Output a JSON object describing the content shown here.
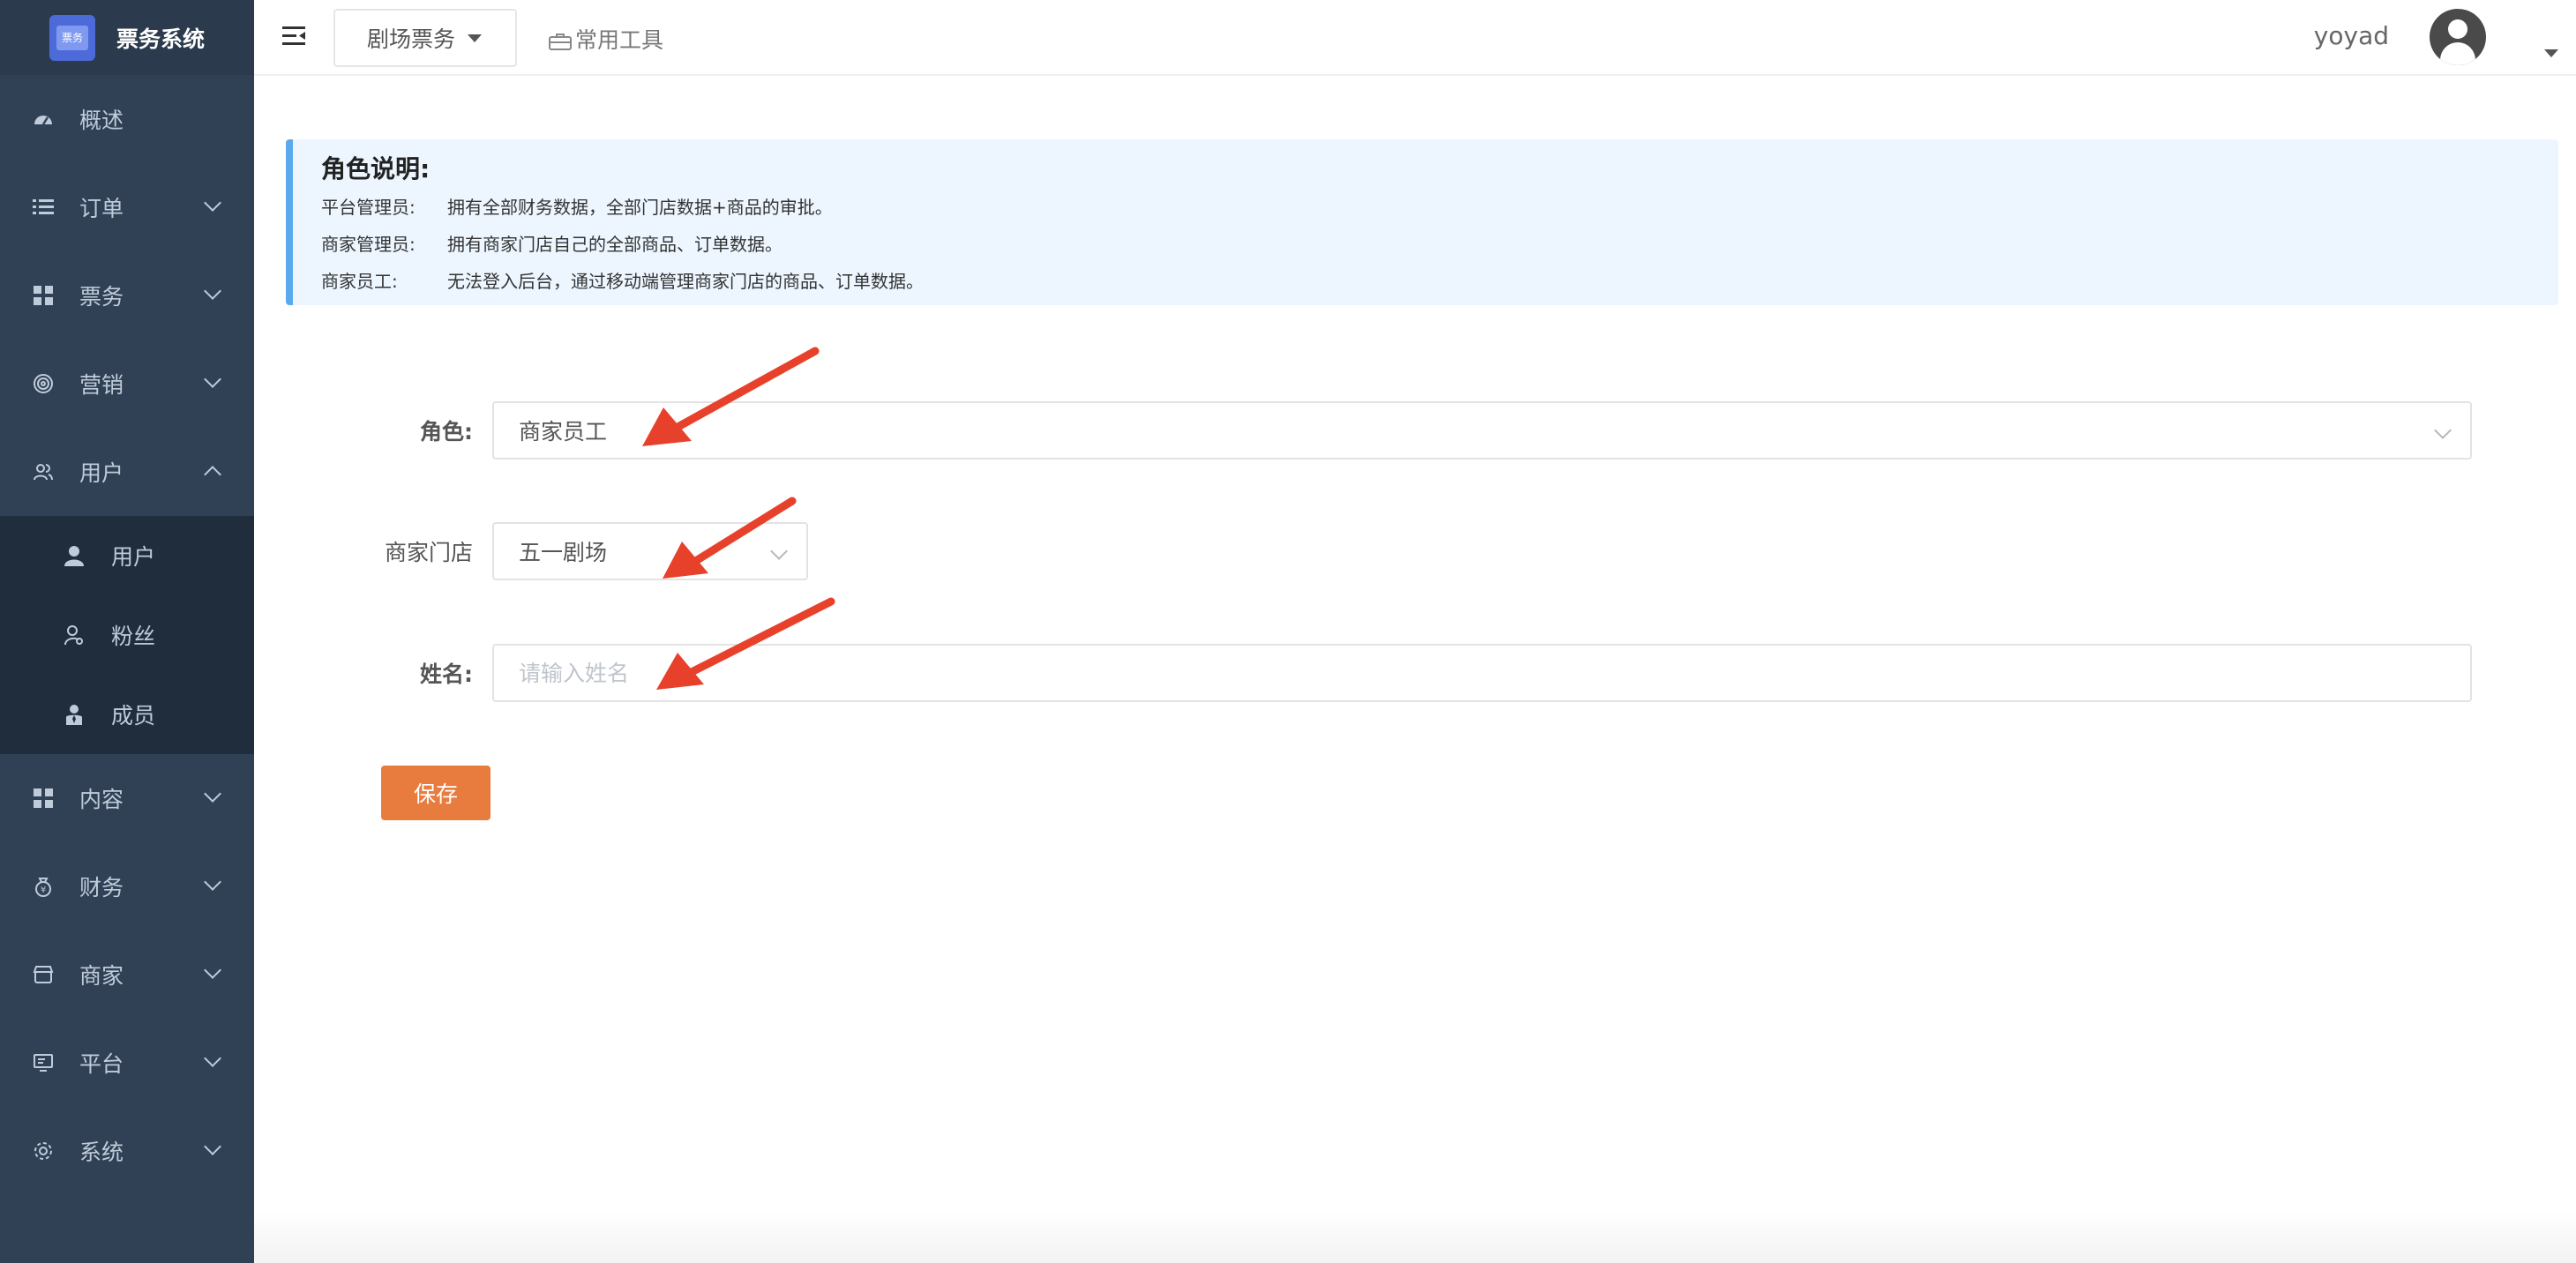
{
  "app": {
    "logo_mark_text": "票务",
    "title": "票务系统"
  },
  "header": {
    "project_select": "剧场票务",
    "tools_label": "常用工具",
    "user_name": "yoyad"
  },
  "sidebar": {
    "items": [
      {
        "label": "概述",
        "icon": "dashboard-icon"
      },
      {
        "label": "订单",
        "icon": "list-icon"
      },
      {
        "label": "票务",
        "icon": "grid-icon"
      },
      {
        "label": "营销",
        "icon": "target-icon"
      },
      {
        "label": "用户",
        "icon": "users-icon"
      },
      {
        "label": "内容",
        "icon": "grid-icon"
      },
      {
        "label": "财务",
        "icon": "money-bag-icon"
      },
      {
        "label": "商家",
        "icon": "store-icon"
      },
      {
        "label": "平台",
        "icon": "monitor-icon"
      },
      {
        "label": "系统",
        "icon": "gear-icon"
      }
    ],
    "user_submenu": [
      {
        "label": "用户",
        "icon": "person-icon"
      },
      {
        "label": "粉丝",
        "icon": "fans-icon"
      },
      {
        "label": "成员",
        "icon": "staff-icon"
      }
    ]
  },
  "notice": {
    "title": "角色说明:",
    "rows": [
      {
        "role": "平台管理员:",
        "desc": "拥有全部财务数据，全部门店数据+商品的审批。"
      },
      {
        "role": "商家管理员:",
        "desc": "拥有商家门店自己的全部商品、订单数据。"
      },
      {
        "role": "商家员工:",
        "desc": "无法登入后台，通过移动端管理商家门店的商品、订单数据。"
      }
    ]
  },
  "form": {
    "role_label": "角色:",
    "role_value": "商家员工",
    "store_label": "商家门店",
    "store_value": "五一剧场",
    "name_label": "姓名:",
    "name_placeholder": "请输入姓名",
    "save_label": "保存"
  },
  "colors": {
    "sidebar_bg": "#304156",
    "accent_button": "#e87c3e",
    "notice_border": "#5aa9ee",
    "annotation_arrow": "#e8412b"
  }
}
